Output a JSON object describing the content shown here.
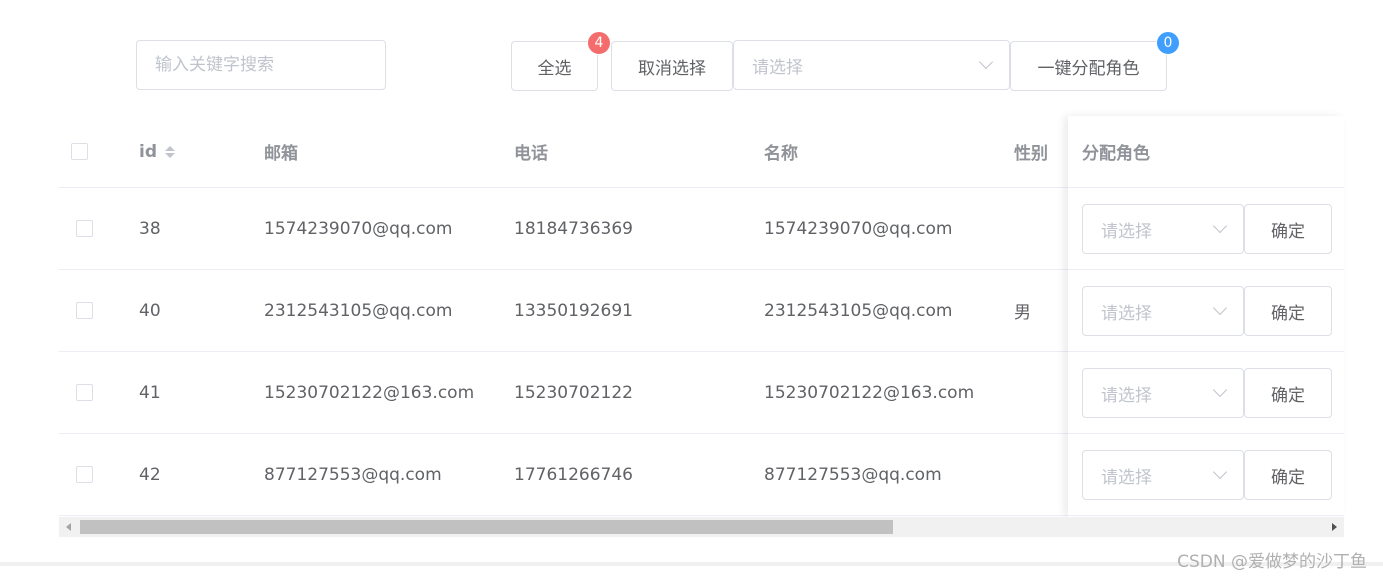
{
  "toolbar": {
    "search_placeholder": "输入关键字搜索",
    "select_all_label": "全选",
    "select_all_badge": "4",
    "cancel_label": "取消选择",
    "role_select_placeholder": "请选择",
    "assign_label": "一键分配角色",
    "assign_badge": "0"
  },
  "table": {
    "columns": {
      "id": "id",
      "email": "邮箱",
      "phone": "电话",
      "name": "名称",
      "gender": "性别",
      "assign_role": "分配角色"
    },
    "rows": [
      {
        "id": "38",
        "email": "1574239070@qq.com",
        "phone": "18184736369",
        "name": "1574239070@qq.com",
        "gender": ""
      },
      {
        "id": "40",
        "email": "2312543105@qq.com",
        "phone": "13350192691",
        "name": "2312543105@qq.com",
        "gender": "男"
      },
      {
        "id": "41",
        "email": "15230702122@163.com",
        "phone": "15230702122",
        "name": "15230702122@163.com",
        "gender": ""
      },
      {
        "id": "42",
        "email": "877127553@qq.com",
        "phone": "17761266746",
        "name": "877127553@qq.com",
        "gender": ""
      }
    ],
    "row_select_placeholder": "请选择",
    "row_confirm_label": "确定"
  },
  "colors": {
    "badge_red": "#f56c6c",
    "badge_blue": "#409eff",
    "border": "#dcdfe6",
    "header_text": "#909399"
  },
  "watermark": "CSDN @爱做梦的沙丁鱼"
}
